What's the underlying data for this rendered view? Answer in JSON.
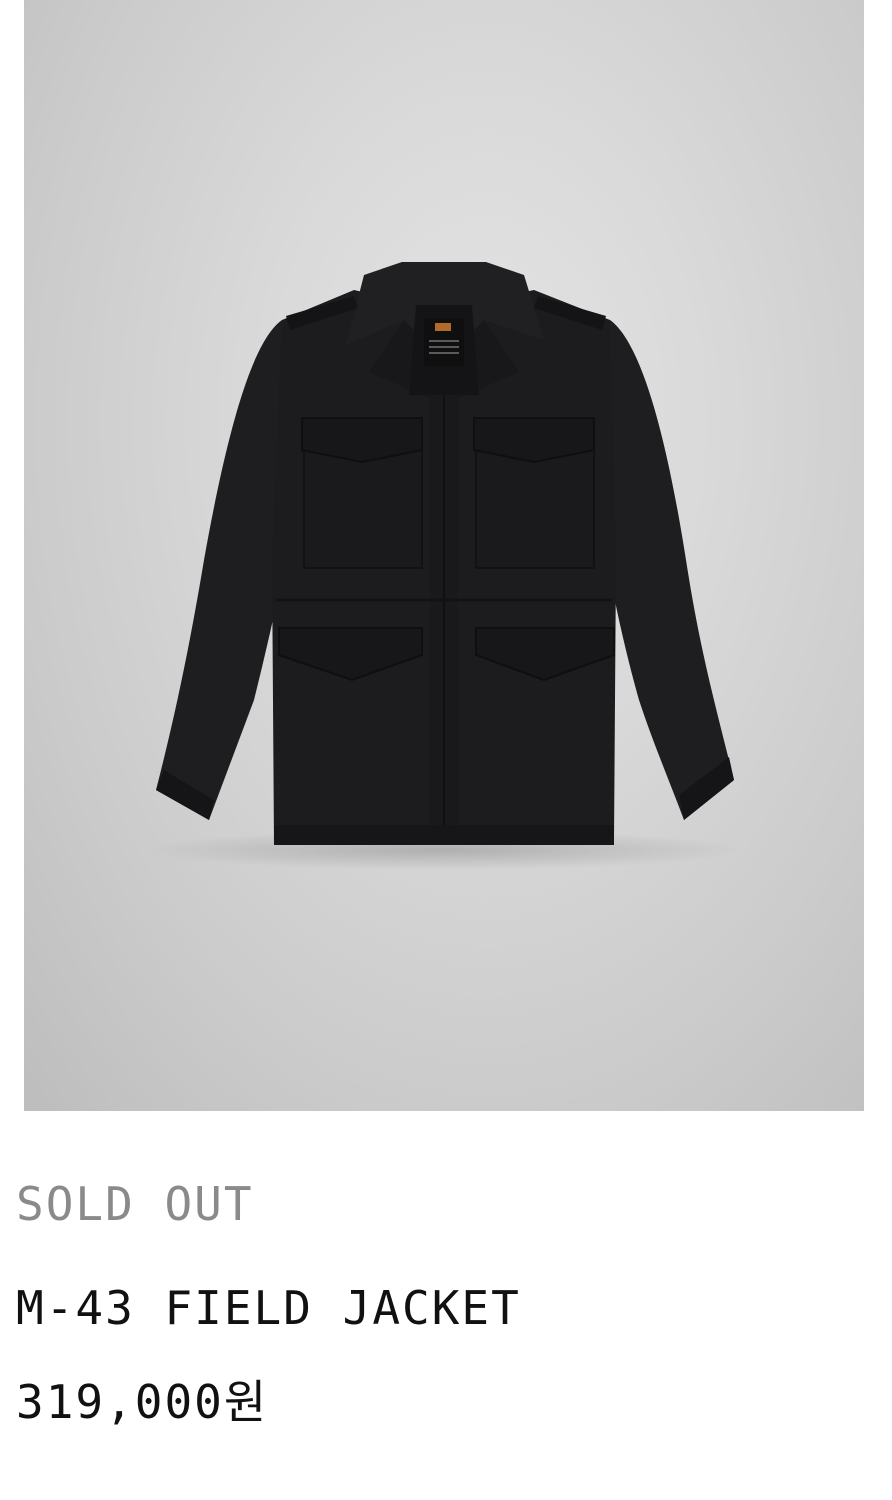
{
  "product": {
    "status": "SOLD OUT",
    "name": "M-43 FIELD JACKET",
    "price": "319,000원",
    "image_description_icon": "black-field-jacket-photo"
  },
  "colors": {
    "status_text": "#8a8a8a",
    "primary_text": "#111111",
    "jacket": "#1c1c1e",
    "backdrop": "#d4d4d4"
  }
}
